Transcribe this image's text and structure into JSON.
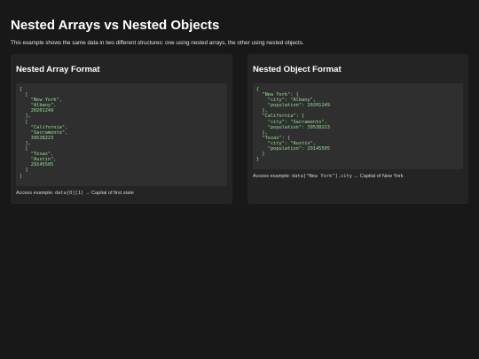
{
  "page": {
    "title": "Nested Arrays vs Nested Objects",
    "intro": "This example shows the same data in two different structures: one using nested arrays, the other using nested objects."
  },
  "array_card": {
    "heading": "Nested Array Format",
    "code": "[\n  [\n    \"New York\",\n    \"Albany\",\n    20201249\n  ],\n  [\n    \"California\",\n    \"Sacramento\",\n    39538223\n  ],\n  [\n    \"Texas\",\n    \"Austin\",\n    29145505\n  ]\n]",
    "access_prefix": "Access example: ",
    "access_code": "data[0][1]",
    "access_suffix": " → Capital of first state"
  },
  "object_card": {
    "heading": "Nested Object Format",
    "code": "{\n  \"New York\": {\n    \"city\": \"Albany\",\n    \"population\": 20201249\n  },\n  \"California\": {\n    \"city\": \"Sacramento\",\n    \"population\": 39538223\n  },\n  \"Texas\": {\n    \"city\": \"Austin\",\n    \"population\": 29145505\n  }\n}",
    "access_prefix": "Access example: ",
    "access_code": "data[\"New York\"].city",
    "access_suffix": " → Capital of New York"
  },
  "colors": {
    "background": "#181818",
    "card": "#242424",
    "code_block": "#2f2f2f",
    "code_text": "#98e09b"
  }
}
